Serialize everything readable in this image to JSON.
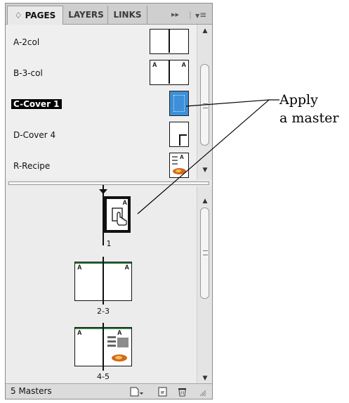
{
  "tabs": [
    {
      "label": "♢ PAGES"
    },
    {
      "label": "LAYERS"
    },
    {
      "label": "LINKS"
    }
  ],
  "tab_menu": {
    "forward": "▸▸",
    "menu": "≡"
  },
  "masters": [
    {
      "label": "A-2col"
    },
    {
      "label": "B-3-col"
    },
    {
      "label": "C-Cover 1"
    },
    {
      "label": "D-Cover 4"
    },
    {
      "label": "R-Recipe"
    }
  ],
  "pages": [
    {
      "label": "1"
    },
    {
      "label": "2-3"
    },
    {
      "label": "4-5"
    }
  ],
  "thumb_prefix": "A",
  "status": {
    "masters_count": "5 Masters"
  },
  "callout": {
    "line1": "Apply",
    "line2": "a master"
  },
  "colors": {
    "cover_blue": "#3c8fd8",
    "tab_bar": "#cfcfcf",
    "panel_bg": "#e9e9e9"
  }
}
